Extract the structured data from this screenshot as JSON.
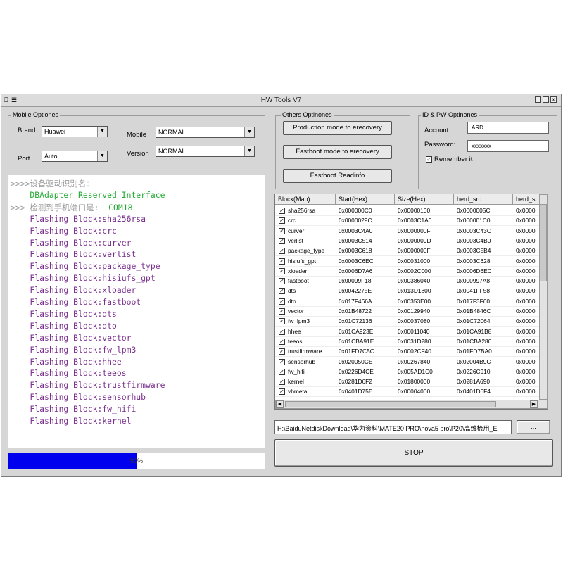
{
  "window": {
    "title": "HW Tools V7"
  },
  "mobile_options": {
    "legend": "Mobile Optiones",
    "brand_label": "Brand",
    "brand_value": "Huawei",
    "port_label": "Port",
    "port_value": "Auto",
    "mobile_label": "Mobile",
    "mobile_value": "NORMAL",
    "version_label": "Version",
    "version_value": "NORMAL"
  },
  "others_options": {
    "legend": "Others Optinones",
    "production_label": "Production mode to erecovery",
    "fastboot_label": "Fastboot mode to erecovery",
    "readinfo_label": "Fastboot Readinfo"
  },
  "idpw": {
    "legend": "ID & PW Optinones",
    "account_label": "Account:",
    "account_value": "ARD",
    "password_label": "Password:",
    "password_value": "xxxxxxx",
    "remember_label": "Remember it"
  },
  "log": {
    "lines": [
      {
        "text": ">>>>设备驱动识别名：",
        "color": "#9a9a9a"
      },
      {
        "text": "    DBAdapter Reserved Interface",
        "color": "#22aa33"
      },
      {
        "text": ">>> 检测到手机端口是:  COM18",
        "color": "#9a9a9a",
        "accent": "COM18",
        "accent_color": "#22aa33"
      },
      {
        "text": "    Flashing Block:sha256rsa",
        "color": "#7a2e8e"
      },
      {
        "text": "    Flashing Block:crc",
        "color": "#7a2e8e"
      },
      {
        "text": "    Flashing Block:curver",
        "color": "#7a2e8e"
      },
      {
        "text": "    Flashing Block:verlist",
        "color": "#7a2e8e"
      },
      {
        "text": "    Flashing Block:package_type",
        "color": "#7a2e8e"
      },
      {
        "text": "    Flashing Block:hisiufs_gpt",
        "color": "#7a2e8e"
      },
      {
        "text": "    Flashing Block:xloader",
        "color": "#7a2e8e"
      },
      {
        "text": "    Flashing Block:fastboot",
        "color": "#7a2e8e"
      },
      {
        "text": "    Flashing Block:dts",
        "color": "#7a2e8e"
      },
      {
        "text": "    Flashing Block:dto",
        "color": "#7a2e8e"
      },
      {
        "text": "    Flashing Block:vector",
        "color": "#7a2e8e"
      },
      {
        "text": "    Flashing Block:fw_lpm3",
        "color": "#7a2e8e"
      },
      {
        "text": "    Flashing Block:hhee",
        "color": "#7a2e8e"
      },
      {
        "text": "    Flashing Block:teeos",
        "color": "#7a2e8e"
      },
      {
        "text": "    Flashing Block:trustfirmware",
        "color": "#7a2e8e"
      },
      {
        "text": "    Flashing Block:sensorhub",
        "color": "#7a2e8e"
      },
      {
        "text": "    Flashing Block:fw_hifi",
        "color": "#7a2e8e"
      },
      {
        "text": "    Flashing Block:kernel",
        "color": "#7a2e8e"
      }
    ]
  },
  "progress": {
    "value": 0.5,
    "label": "50%",
    "color": "#0000ee"
  },
  "grid": {
    "columns": [
      "Block(Map)",
      "Start(Hex)",
      "Size(Hex)",
      "herd_src",
      "herd_si"
    ],
    "rows": [
      [
        "sha256rsa",
        "0x000000C0",
        "0x00000100",
        "0x0000005C",
        "0x0000"
      ],
      [
        "crc",
        "0x0000029C",
        "0x0003C1A0",
        "0x000001C0",
        "0x0000"
      ],
      [
        "curver",
        "0x0003C4A0",
        "0x0000000F",
        "0x0003C43C",
        "0x0000"
      ],
      [
        "verlist",
        "0x0003C514",
        "0x0000009D",
        "0x0003C4B0",
        "0x0000"
      ],
      [
        "package_type",
        "0x0003C618",
        "0x0000000F",
        "0x0003C5B4",
        "0x0000"
      ],
      [
        "hisiufs_gpt",
        "0x0003C6EC",
        "0x00031000",
        "0x0003C628",
        "0x0000"
      ],
      [
        "xloader",
        "0x0006D7A6",
        "0x0002C000",
        "0x0006D6EC",
        "0x0000"
      ],
      [
        "fastboot",
        "0x00099F18",
        "0x00386040",
        "0x000997A8",
        "0x0000"
      ],
      [
        "dts",
        "0x0042275E",
        "0x013D1800",
        "0x0041FF58",
        "0x0000"
      ],
      [
        "dto",
        "0x017F466A",
        "0x00353E00",
        "0x017F3F60",
        "0x0000"
      ],
      [
        "vector",
        "0x01B48722",
        "0x00129940",
        "0x01B4846C",
        "0x0000"
      ],
      [
        "fw_lpm3",
        "0x01C72136",
        "0x00037080",
        "0x01C72064",
        "0x0000"
      ],
      [
        "hhee",
        "0x01CA923E",
        "0x00011040",
        "0x01CA91B8",
        "0x0000"
      ],
      [
        "teeos",
        "0x01CBA91E",
        "0x0031D280",
        "0x01CBA280",
        "0x0000"
      ],
      [
        "trustfirmware",
        "0x01FD7C5C",
        "0x0002CF40",
        "0x01FD7BA0",
        "0x0000"
      ],
      [
        "sensorhub",
        "0x020050CE",
        "0x00267840",
        "0x02004B9C",
        "0x0000"
      ],
      [
        "fw_hifi",
        "0x0226D4CE",
        "0x005AD1C0",
        "0x0226C910",
        "0x0000"
      ],
      [
        "kernel",
        "0x0281D6F2",
        "0x01800000",
        "0x0281A690",
        "0x0000"
      ],
      [
        "vbmeta",
        "0x0401D75E",
        "0x00004000",
        "0x0401D6F4",
        "0x0000"
      ]
    ]
  },
  "path": {
    "value": "H:\\BaiduNetdiskDownload\\华为资料\\MATE20 PRO\\nova5 pro\\P20\\高维梳用_E",
    "browse_label": "..."
  },
  "stop_label": "STOP"
}
